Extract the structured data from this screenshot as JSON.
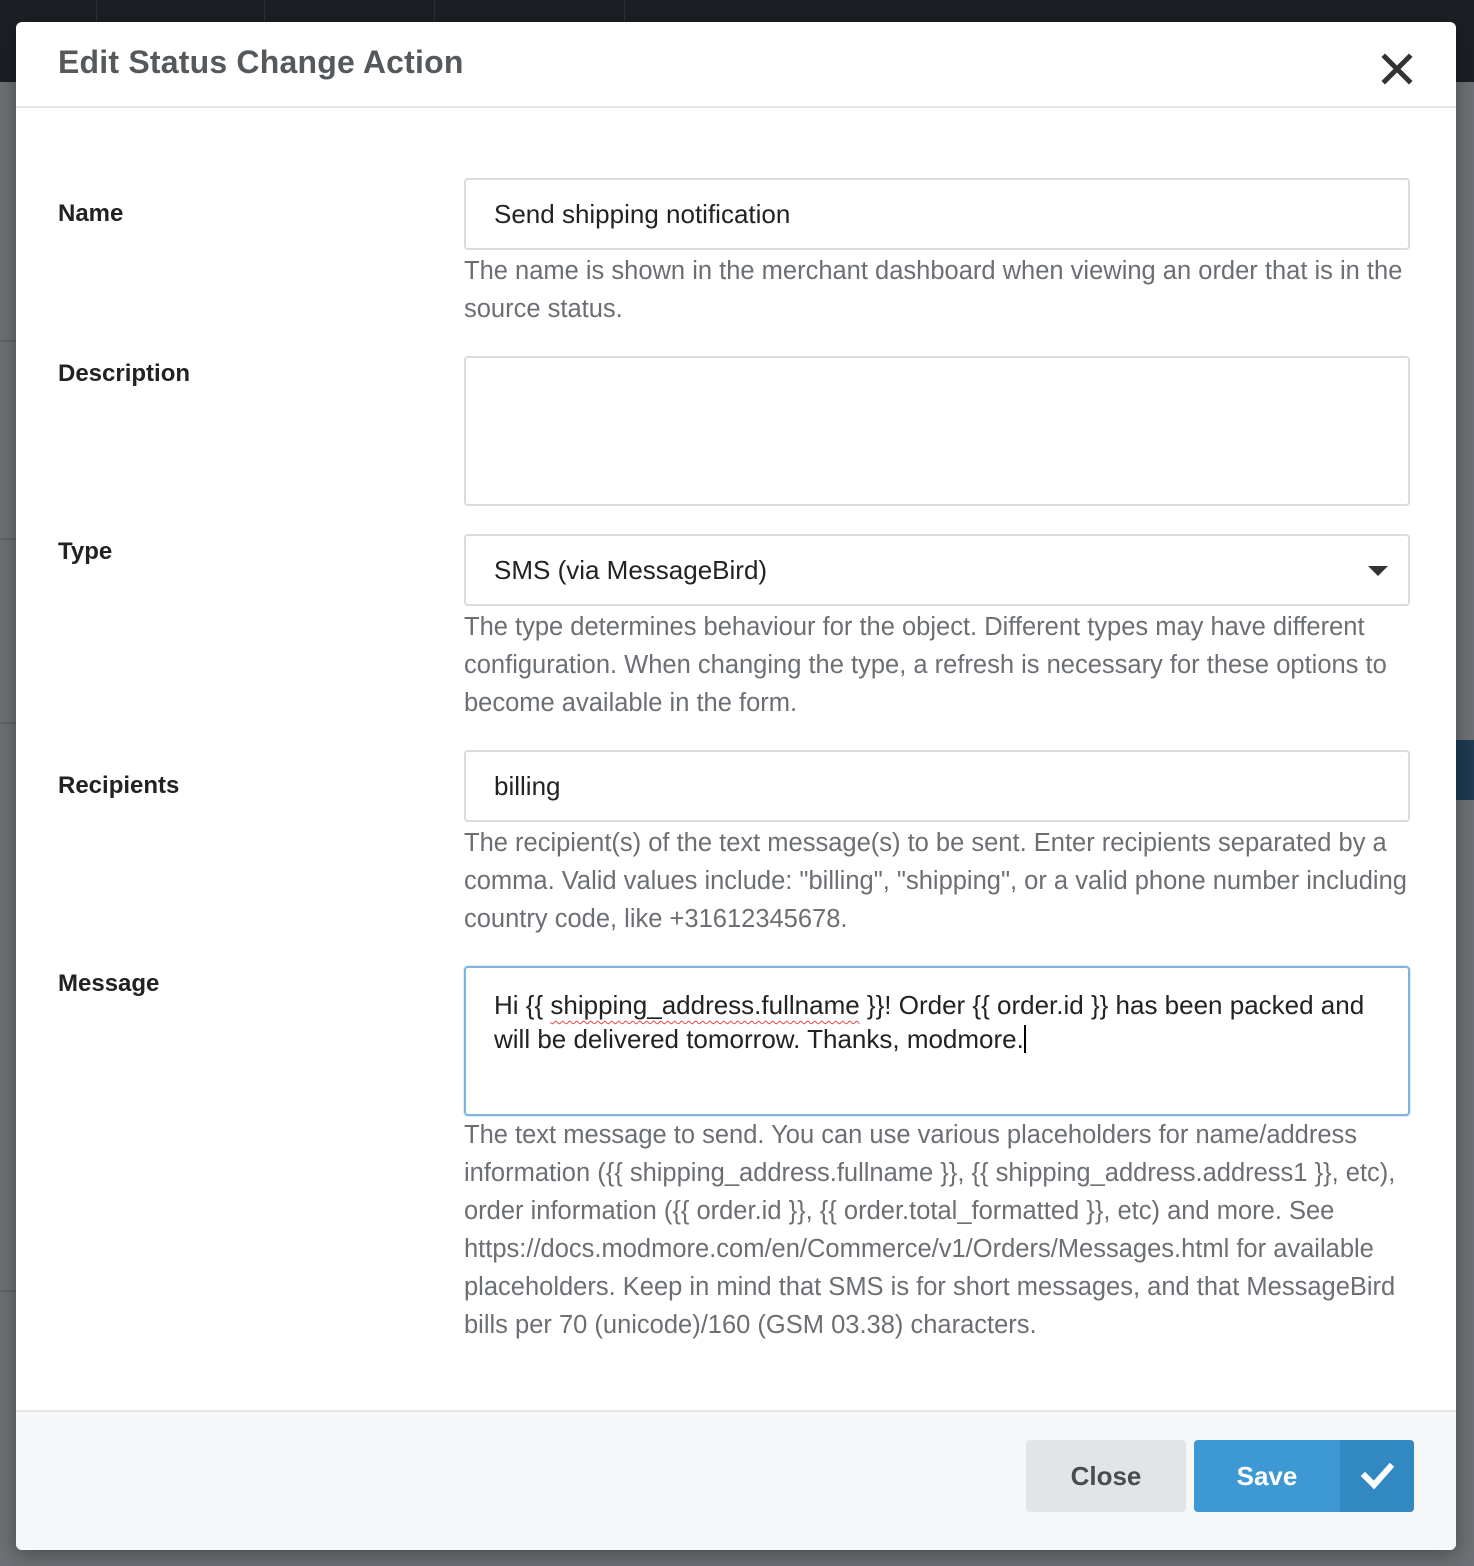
{
  "modal": {
    "title": "Edit Status Change Action",
    "close_icon": "close-icon"
  },
  "fields": {
    "name": {
      "label": "Name",
      "value": "Send shipping notification",
      "help": "The name is shown in the merchant dashboard when viewing an order that is in the source status."
    },
    "description": {
      "label": "Description",
      "value": ""
    },
    "type": {
      "label": "Type",
      "selected": "SMS (via MessageBird)",
      "help": "The type determines behaviour for the object. Different types may have different configuration. When changing the type, a refresh is necessary for these options to become available in the form."
    },
    "recipients": {
      "label": "Recipients",
      "value": "billing",
      "help": "The recipient(s) of the text message(s) to be sent. Enter recipients separated by a comma. Valid values include: \"billing\", \"shipping\", or a valid phone number including country code, like +31612345678."
    },
    "message": {
      "label": "Message",
      "value_part1": "Hi {{ ",
      "value_misspelled": "shipping_address.fullname",
      "value_part2": " }}! Order {{ order.id }} has been packed and will be delivered tomorrow. Thanks, modmore.",
      "help": "The text message to send. You can use various placeholders for name/address information ({{ shipping_address.fullname }}, {{ shipping_address.address1 }}, etc), order information ({{ order.id }}, {{ order.total_formatted }}, etc) and more. See https://docs.modmore.com/en/Commerce/v1/Orders/Messages.html for available placeholders. Keep in mind that SMS is for short messages, and that MessageBird bills per 70 (unicode)/160 (GSM 03.38) characters."
    }
  },
  "footer": {
    "close_label": "Close",
    "save_label": "Save",
    "save_icon": "checkmark-icon"
  },
  "colors": {
    "primary": "#3d98d3",
    "primary_dark": "#3289c2",
    "focus_border": "#7fb3dd"
  }
}
